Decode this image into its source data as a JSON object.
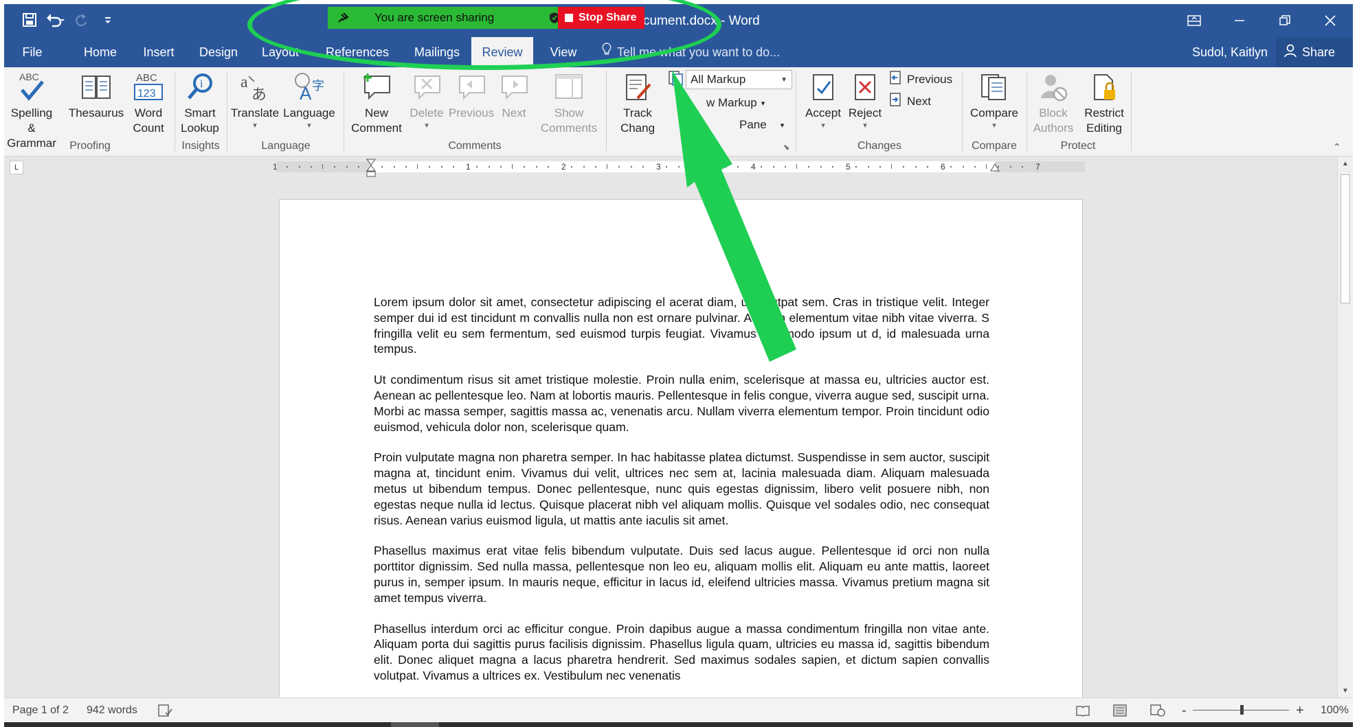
{
  "app": {
    "doc_title": "cument.docx - Word"
  },
  "screen_share": {
    "label": "You are screen sharing",
    "stop_label": "Stop Share"
  },
  "tabs": [
    "File",
    "Home",
    "Insert",
    "Design",
    "Layout",
    "References",
    "Mailings",
    "Review",
    "View"
  ],
  "active_tab": "Review",
  "tell_me": "Tell me what you want to do...",
  "user": {
    "name": "Sudol, Kaitlyn",
    "share_label": "Share"
  },
  "ribbon": {
    "proofing": {
      "spelling_1": "Spelling &",
      "spelling_2": "Grammar",
      "spelling_icon_text": "ABC",
      "thesaurus": "Thesaurus",
      "wordcount_1": "Word",
      "wordcount_2": "Count",
      "wordcount_icon_top": "ABC",
      "wordcount_icon_bottom": "123",
      "label": "Proofing"
    },
    "insights": {
      "smart_1": "Smart",
      "smart_2": "Lookup",
      "label": "Insights"
    },
    "language": {
      "translate": "Translate",
      "language": "Language",
      "label": "Language"
    },
    "comments": {
      "new_1": "New",
      "new_2": "Comment",
      "delete": "Delete",
      "previous": "Previous",
      "next": "Next",
      "show_1": "Show",
      "show_2": "Comments",
      "label": "Comments"
    },
    "tracking": {
      "track_1": "Track",
      "track_2": "Chang",
      "markup_select": "All Markup",
      "show_markup": "w Markup",
      "pane": "Pane"
    },
    "changes": {
      "accept": "Accept",
      "reject": "Reject",
      "previous": "Previous",
      "next": "Next",
      "label": "Changes"
    },
    "compare": {
      "compare": "Compare",
      "label": "Compare"
    },
    "protect": {
      "block_1": "Block",
      "block_2": "Authors",
      "restrict_1": "Restrict",
      "restrict_2": "Editing",
      "label": "Protect"
    }
  },
  "ruler_numbers": [
    "1",
    "1",
    "2",
    "3",
    "4",
    "5",
    "6",
    "7"
  ],
  "document": {
    "paragraphs": [
      "Lorem ipsum dolor sit amet, consectetur adipiscing el                 acerat diam, ut volutpat sem. Cras in tristique velit. Integer semper dui id est tincidunt            m convallis nulla non est ornare pulvinar. Aenean elementum vitae nibh vitae viverra. S            fringilla velit eu sem fermentum, sed euismod turpis feugiat. Vivamus commodo ipsum ut            d, id malesuada urna tempus.",
      "Ut condimentum risus sit amet tristique molestie. Proin nulla enim, scelerisque at massa eu, ultricies auctor est. Aenean ac pellentesque leo. Nam at lobortis mauris. Pellentesque in felis congue, viverra augue sed, suscipit urna. Morbi ac massa semper, sagittis massa ac, venenatis arcu. Nullam viverra elementum tempor. Proin tincidunt odio euismod, vehicula dolor non, scelerisque quam.",
      "Proin vulputate magna non pharetra semper. In hac habitasse platea dictumst. Suspendisse in sem auctor, suscipit magna at, tincidunt enim. Vivamus dui velit, ultrices nec sem at, lacinia malesuada diam. Aliquam malesuada metus ut bibendum tempus. Donec pellentesque, nunc quis egestas dignissim, libero velit posuere nibh, non egestas neque nulla id lectus. Quisque placerat nibh vel aliquam mollis. Quisque vel sodales odio, nec consequat risus. Aenean varius euismod ligula, ut mattis ante iaculis sit amet.",
      "Phasellus maximus erat vitae felis bibendum vulputate. Duis sed lacus augue. Pellentesque id orci non nulla porttitor dignissim. Sed nulla massa, pellentesque non leo eu, aliquam mollis elit. Aliquam eu ante mattis, laoreet purus in, semper ipsum. In mauris neque, efficitur in lacus id, eleifend ultricies massa. Vivamus pretium magna sit amet tempus viverra.",
      "Phasellus interdum orci ac efficitur congue. Proin dapibus augue a massa condimentum fringilla non vitae ante. Aliquam porta dui sagittis purus facilisis dignissim. Phasellus ligula quam, ultricies eu massa id, sagittis bibendum elit. Donec aliquet magna a lacus pharetra hendrerit. Sed maximus sodales sapien, et dictum sapien convallis volutpat. Vivamus a ultrices ex. Vestibulum nec venenatis"
    ]
  },
  "status": {
    "page": "Page 1 of 2",
    "words": "942 words",
    "zoom": "100%",
    "zoom_minus": "-",
    "zoom_plus": "+"
  },
  "colors": {
    "word_blue": "#2b579a",
    "annotation_green": "#1fcf53",
    "share_green": "#2bba35",
    "stop_red": "#e81123"
  }
}
